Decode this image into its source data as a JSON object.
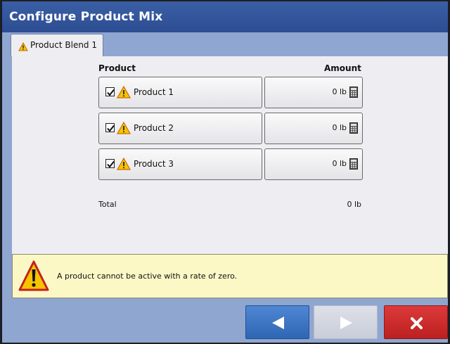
{
  "window": {
    "title": "Configure Product Mix"
  },
  "tabs": [
    {
      "label": "Product Blend 1",
      "icon": "warning-icon",
      "active": true
    }
  ],
  "table": {
    "headers": {
      "product": "Product",
      "amount": "Amount"
    },
    "rows": [
      {
        "checked": true,
        "name": "Product 1",
        "amount": "0 lb"
      },
      {
        "checked": true,
        "name": "Product 2",
        "amount": "0 lb"
      },
      {
        "checked": true,
        "name": "Product 3",
        "amount": "0 lb"
      }
    ],
    "total": {
      "label": "Total",
      "value": "0 lb"
    }
  },
  "warning": {
    "message": "A product cannot be active with a rate of zero.",
    "icon": "warning-icon"
  },
  "nav": {
    "back": {
      "icon": "arrow-left-icon",
      "enabled": true
    },
    "next": {
      "icon": "arrow-right-icon",
      "enabled": false
    },
    "close": {
      "icon": "close-icon",
      "enabled": true
    }
  },
  "colors": {
    "titlebar": "#2d4d91",
    "background": "#8fa6d0",
    "panel": "#eeeef2",
    "warning_bg": "#fbf8c6",
    "back_button": "#3a74c4",
    "close_button": "#cc2a2a",
    "next_button_disabled": "#d4d7e0"
  }
}
